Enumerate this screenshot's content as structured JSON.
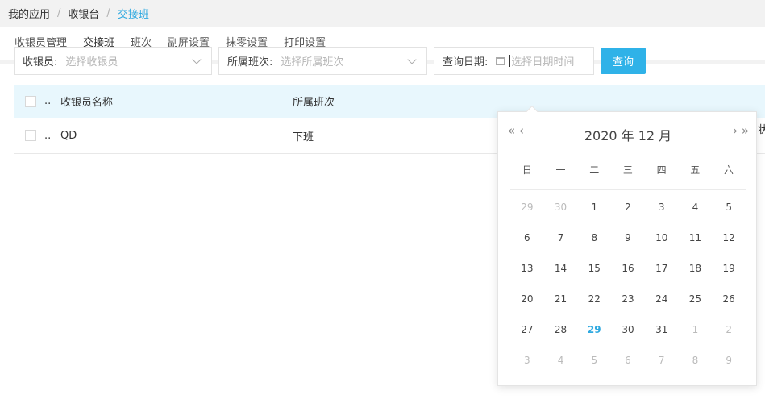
{
  "breadcrumb": {
    "items": [
      "我的应用",
      "收银台"
    ],
    "current": "交接班",
    "separator": "/"
  },
  "tabs": [
    "收银员管理",
    "交接班",
    "班次",
    "副屏设置",
    "抹零设置",
    "打印设置"
  ],
  "filters": {
    "cashier_label": "收银员:",
    "cashier_placeholder": "选择收银员",
    "shift_label": "所属班次:",
    "shift_placeholder": "选择所属班次",
    "date_label": "查询日期:",
    "date_placeholder": "选择日期时间"
  },
  "query_button": "查询",
  "table": {
    "columns": [
      "收银员名称",
      "所属班次"
    ],
    "overflow_dots": "..",
    "rows": [
      {
        "name": "QD",
        "shift": "下班"
      }
    ],
    "peek_text": "状"
  },
  "calendar": {
    "title": "2020 年  12 月",
    "nav": {
      "prev_year": "«",
      "prev_month": "‹",
      "next_month": "›",
      "next_year": "»"
    },
    "weekdays": [
      "日",
      "一",
      "二",
      "三",
      "四",
      "五",
      "六"
    ],
    "weeks": [
      [
        29,
        30,
        1,
        2,
        3,
        4,
        5
      ],
      [
        6,
        7,
        8,
        9,
        10,
        11,
        12
      ],
      [
        13,
        14,
        15,
        16,
        17,
        18,
        19
      ],
      [
        20,
        21,
        22,
        23,
        24,
        25,
        26
      ],
      [
        27,
        28,
        29,
        30,
        31,
        1,
        2
      ],
      [
        3,
        4,
        5,
        6,
        7,
        8,
        9
      ]
    ],
    "today": 29,
    "accent_color": "#2fa9e0"
  }
}
